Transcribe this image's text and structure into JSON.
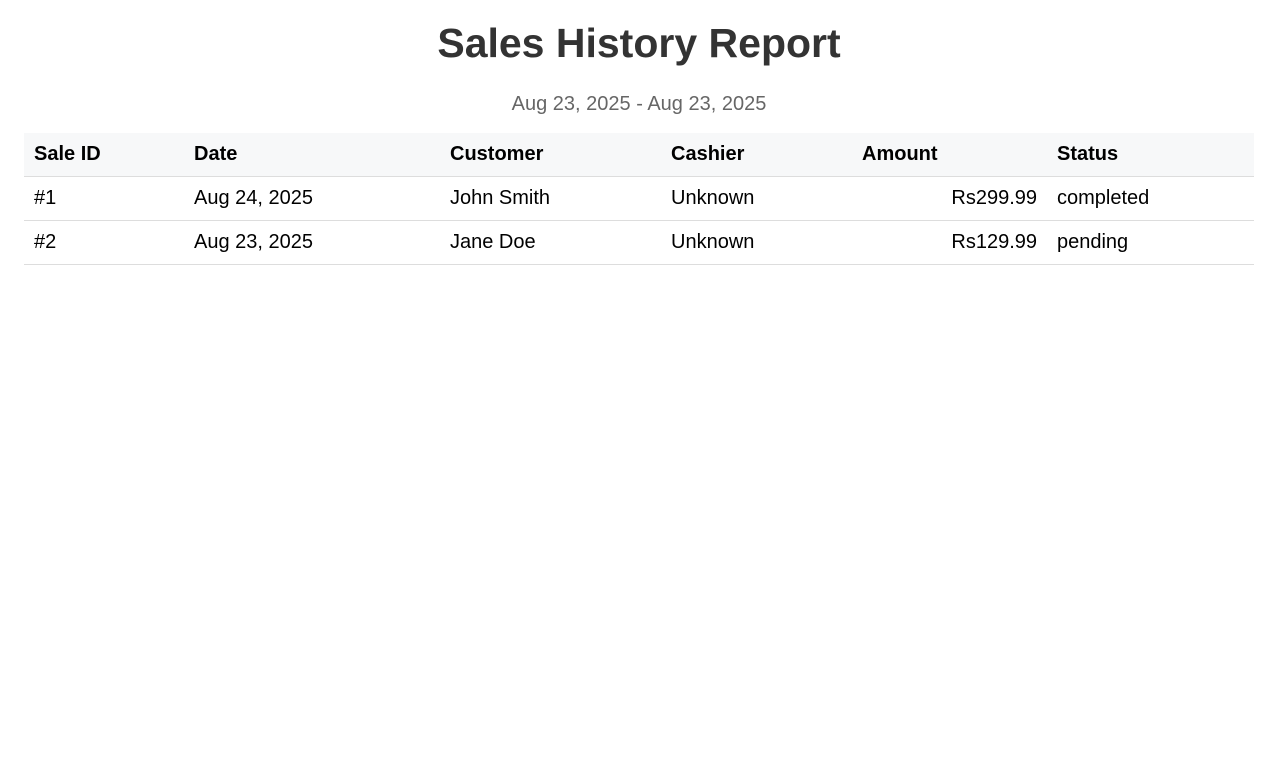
{
  "report": {
    "title": "Sales History Report",
    "date_range": "Aug 23, 2025 - Aug 23, 2025"
  },
  "table": {
    "headers": {
      "sale_id": "Sale ID",
      "date": "Date",
      "customer": "Customer",
      "cashier": "Cashier",
      "amount": "Amount",
      "status": "Status"
    },
    "rows": [
      {
        "sale_id": "#1",
        "date": "Aug 24, 2025",
        "customer": "John Smith",
        "cashier": "Unknown",
        "amount": "Rs299.99",
        "status": "completed"
      },
      {
        "sale_id": "#2",
        "date": "Aug 23, 2025",
        "customer": "Jane Doe",
        "cashier": "Unknown",
        "amount": "Rs129.99",
        "status": "pending"
      }
    ]
  },
  "colors": {
    "title": "#333333",
    "subtitle": "#666666",
    "header_background": "#f7f8f9",
    "row_border": "#dddddd"
  }
}
